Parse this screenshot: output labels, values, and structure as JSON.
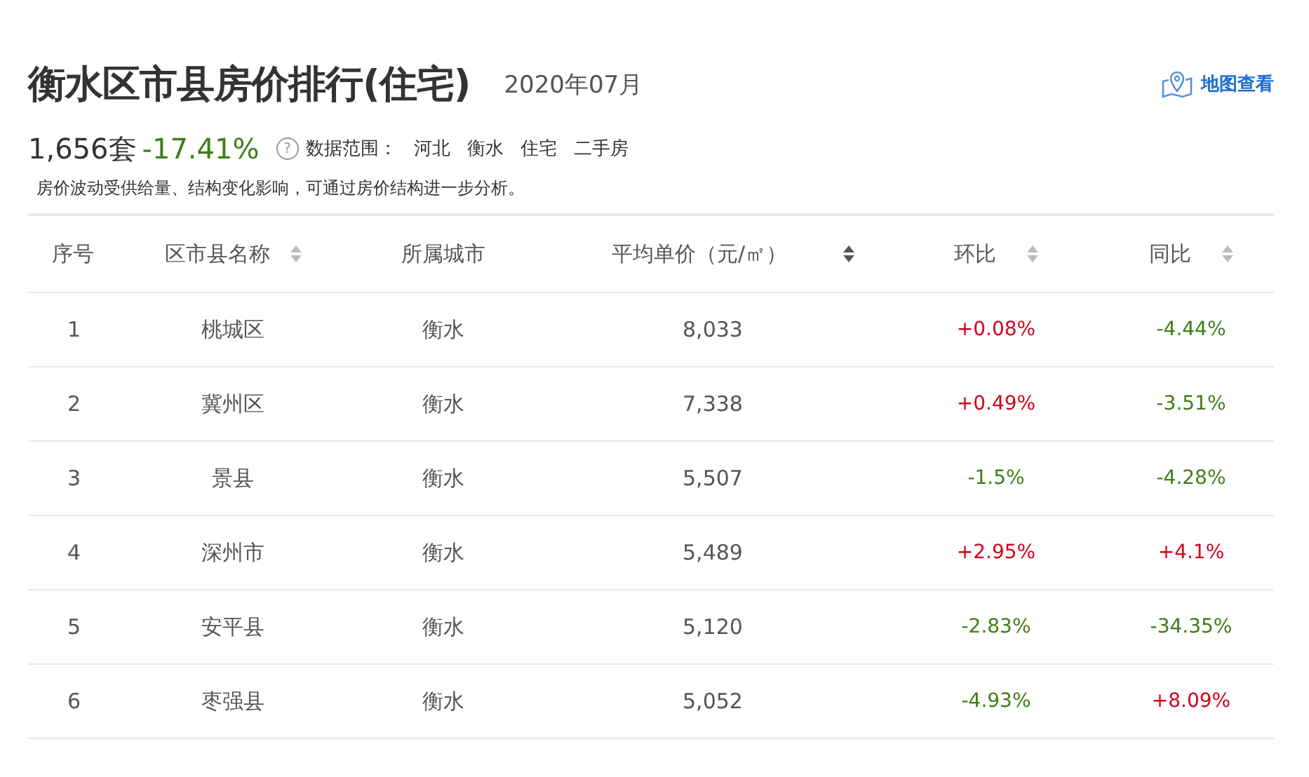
{
  "header": {
    "title": "衡水区市县房价排行(住宅)",
    "date": "2020年07月",
    "map_link": "地图查看"
  },
  "summary": {
    "count": "1,656套",
    "change": {
      "text": "-17.41%",
      "color": "#3f7d18"
    },
    "help_icon": "?",
    "scope_label": "数据范围：",
    "scope": [
      "河北",
      "衡水",
      "住宅",
      "二手房"
    ],
    "note": "房价波动受供给量、结构变化影响，可通过房价结构进一步分析。"
  },
  "table": {
    "columns": [
      {
        "label": "序号",
        "sortable": false,
        "sort_active": false
      },
      {
        "label": "区市县名称",
        "sortable": true,
        "sort_active": false
      },
      {
        "label": "所属城市",
        "sortable": false,
        "sort_active": false
      },
      {
        "label": "平均单价（元/㎡）",
        "sortable": true,
        "sort_active": true
      },
      {
        "label": "环比",
        "sortable": true,
        "sort_active": false
      },
      {
        "label": "同比",
        "sortable": true,
        "sort_active": false
      }
    ],
    "rows": [
      {
        "index": "1",
        "name": "桃城区",
        "city": "衡水",
        "price": "8,033",
        "mom": {
          "text": "+0.08%",
          "color": "#d0021b"
        },
        "yoy": {
          "text": "-4.44%",
          "color": "#3f7d18"
        }
      },
      {
        "index": "2",
        "name": "冀州区",
        "city": "衡水",
        "price": "7,338",
        "mom": {
          "text": "+0.49%",
          "color": "#d0021b"
        },
        "yoy": {
          "text": "-3.51%",
          "color": "#3f7d18"
        }
      },
      {
        "index": "3",
        "name": "景县",
        "city": "衡水",
        "price": "5,507",
        "mom": {
          "text": "-1.5%",
          "color": "#3f7d18"
        },
        "yoy": {
          "text": "-4.28%",
          "color": "#3f7d18"
        }
      },
      {
        "index": "4",
        "name": "深州市",
        "city": "衡水",
        "price": "5,489",
        "mom": {
          "text": "+2.95%",
          "color": "#d0021b"
        },
        "yoy": {
          "text": "+4.1%",
          "color": "#d0021b"
        }
      },
      {
        "index": "5",
        "name": "安平县",
        "city": "衡水",
        "price": "5,120",
        "mom": {
          "text": "-2.83%",
          "color": "#3f7d18"
        },
        "yoy": {
          "text": "-34.35%",
          "color": "#3f7d18"
        }
      },
      {
        "index": "6",
        "name": "枣强县",
        "city": "衡水",
        "price": "5,052",
        "mom": {
          "text": "-4.93%",
          "color": "#3f7d18"
        },
        "yoy": {
          "text": "+8.09%",
          "color": "#d0021b"
        }
      }
    ]
  }
}
